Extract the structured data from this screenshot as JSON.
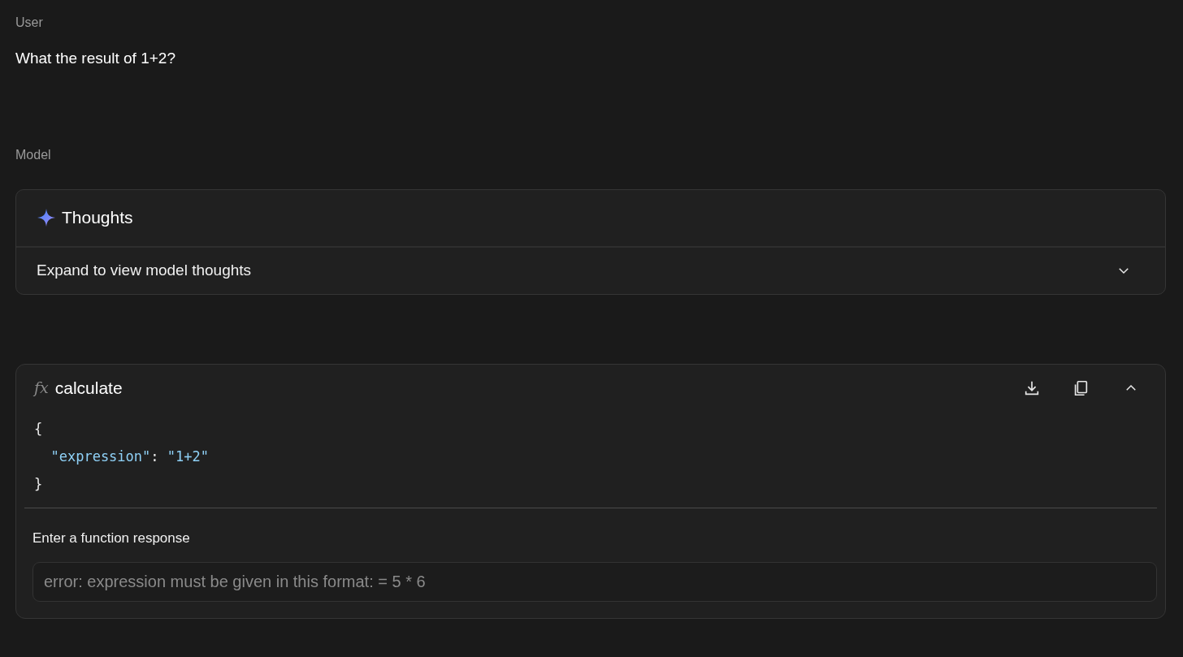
{
  "turns": [
    {
      "role": "User",
      "text": "What the result of 1+2?"
    },
    {
      "role": "Model"
    }
  ],
  "thoughts": {
    "title": "Thoughts",
    "summary": "Expand to view model thoughts",
    "expanded": false
  },
  "function_call": {
    "icon_text": "fx",
    "name": "calculate",
    "expanded": true,
    "code_lines": [
      [
        {
          "kind": "punct",
          "text": "{"
        }
      ],
      [
        {
          "kind": "string",
          "indent": true,
          "text": "\"expression\""
        },
        {
          "kind": "punct",
          "text": ": "
        },
        {
          "kind": "string",
          "text": "\"1+2\""
        }
      ],
      [
        {
          "kind": "punct",
          "text": "}"
        }
      ]
    ],
    "response_label": "Enter a function response",
    "response_field": {
      "placeholder": "error: expression must be given in this format: = 5 * 6"
    }
  }
}
